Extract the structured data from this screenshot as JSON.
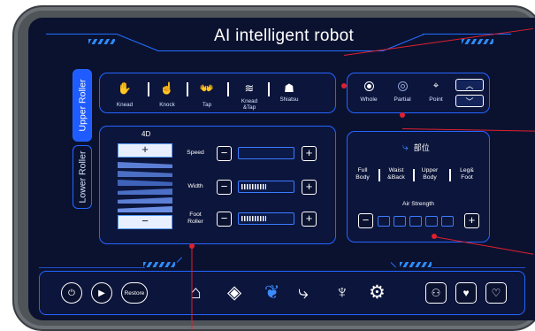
{
  "title": "AI intelligent robot",
  "colors": {
    "background": "#0b1230",
    "accent": "#2566ff",
    "active_tab": "#1f5cff",
    "callout": "#e0202e",
    "text": "#ffffff"
  },
  "roller_tabs": [
    {
      "label": "Upper Roller",
      "active": true
    },
    {
      "label": "Lower Roller",
      "active": false
    }
  ],
  "modes": [
    {
      "label": "Knead",
      "icon": "knead-hand-icon"
    },
    {
      "label": "Knock",
      "icon": "knock-hand-icon"
    },
    {
      "label": "Tap",
      "icon": "tap-hands-icon"
    },
    {
      "label": "Knead\n&Tap",
      "icon": "knead-tap-icon"
    },
    {
      "label": "Shiatsu",
      "icon": "shiatsu-icon"
    }
  ],
  "areas": [
    {
      "label": "Whole",
      "selected": true
    },
    {
      "label": "Partial",
      "selected": false
    },
    {
      "label": "Point",
      "selected": false
    }
  ],
  "roller_4d": {
    "label": "4D",
    "plus": "+",
    "minus": "−"
  },
  "controls": [
    {
      "label": "Speed",
      "minus": "−",
      "plus": "+",
      "level": 0.0
    },
    {
      "label": "Width",
      "minus": "−",
      "plus": "+",
      "level": 0.5
    },
    {
      "label": "Foot\nRoller",
      "minus": "−",
      "plus": "+",
      "level": 0.5
    }
  ],
  "body_part": {
    "title": "部位",
    "items": [
      "Full\nBody",
      "Waist\n&Back",
      "Upper\nBody",
      "Leg&\nFoot"
    ]
  },
  "air_strength": {
    "label": "Air Strength",
    "minus": "−",
    "plus": "+",
    "levels": 5,
    "level": 0
  },
  "bottom_left": {
    "power_icon": "power-icon",
    "play_icon": "play-icon",
    "restore_label": "Restore"
  },
  "bottom_nav": [
    "home-icon",
    "diamond-icon",
    "leaves-icon",
    "stretch-icon",
    "yoga-icon",
    "gear-icon"
  ],
  "bottom_right": [
    "robot-icon",
    "heart-icon",
    "heartbeat-icon"
  ]
}
